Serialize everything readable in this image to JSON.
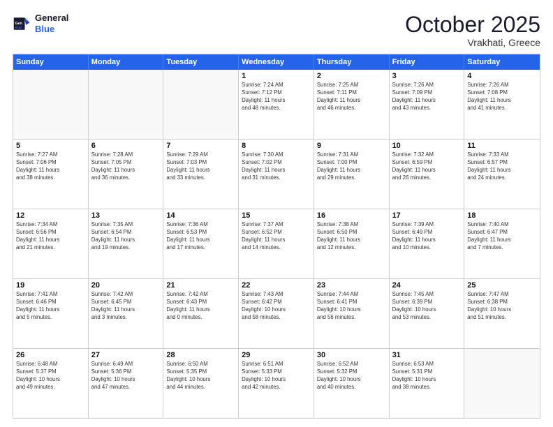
{
  "logo": {
    "line1": "General",
    "line2": "Blue"
  },
  "title": "October 2025",
  "subtitle": "Vrakhati, Greece",
  "days": [
    "Sunday",
    "Monday",
    "Tuesday",
    "Wednesday",
    "Thursday",
    "Friday",
    "Saturday"
  ],
  "rows": [
    [
      {
        "day": "",
        "info": ""
      },
      {
        "day": "",
        "info": ""
      },
      {
        "day": "",
        "info": ""
      },
      {
        "day": "1",
        "info": "Sunrise: 7:24 AM\nSunset: 7:12 PM\nDaylight: 11 hours\nand 48 minutes."
      },
      {
        "day": "2",
        "info": "Sunrise: 7:25 AM\nSunset: 7:11 PM\nDaylight: 11 hours\nand 46 minutes."
      },
      {
        "day": "3",
        "info": "Sunrise: 7:26 AM\nSunset: 7:09 PM\nDaylight: 11 hours\nand 43 minutes."
      },
      {
        "day": "4",
        "info": "Sunrise: 7:26 AM\nSunset: 7:08 PM\nDaylight: 11 hours\nand 41 minutes."
      }
    ],
    [
      {
        "day": "5",
        "info": "Sunrise: 7:27 AM\nSunset: 7:06 PM\nDaylight: 11 hours\nand 38 minutes."
      },
      {
        "day": "6",
        "info": "Sunrise: 7:28 AM\nSunset: 7:05 PM\nDaylight: 11 hours\nand 36 minutes."
      },
      {
        "day": "7",
        "info": "Sunrise: 7:29 AM\nSunset: 7:03 PM\nDaylight: 11 hours\nand 33 minutes."
      },
      {
        "day": "8",
        "info": "Sunrise: 7:30 AM\nSunset: 7:02 PM\nDaylight: 11 hours\nand 31 minutes."
      },
      {
        "day": "9",
        "info": "Sunrise: 7:31 AM\nSunset: 7:00 PM\nDaylight: 11 hours\nand 29 minutes."
      },
      {
        "day": "10",
        "info": "Sunrise: 7:32 AM\nSunset: 6:59 PM\nDaylight: 11 hours\nand 26 minutes."
      },
      {
        "day": "11",
        "info": "Sunrise: 7:33 AM\nSunset: 6:57 PM\nDaylight: 11 hours\nand 24 minutes."
      }
    ],
    [
      {
        "day": "12",
        "info": "Sunrise: 7:34 AM\nSunset: 6:56 PM\nDaylight: 11 hours\nand 21 minutes."
      },
      {
        "day": "13",
        "info": "Sunrise: 7:35 AM\nSunset: 6:54 PM\nDaylight: 11 hours\nand 19 minutes."
      },
      {
        "day": "14",
        "info": "Sunrise: 7:36 AM\nSunset: 6:53 PM\nDaylight: 11 hours\nand 17 minutes."
      },
      {
        "day": "15",
        "info": "Sunrise: 7:37 AM\nSunset: 6:52 PM\nDaylight: 11 hours\nand 14 minutes."
      },
      {
        "day": "16",
        "info": "Sunrise: 7:38 AM\nSunset: 6:50 PM\nDaylight: 11 hours\nand 12 minutes."
      },
      {
        "day": "17",
        "info": "Sunrise: 7:39 AM\nSunset: 6:49 PM\nDaylight: 11 hours\nand 10 minutes."
      },
      {
        "day": "18",
        "info": "Sunrise: 7:40 AM\nSunset: 6:47 PM\nDaylight: 11 hours\nand 7 minutes."
      }
    ],
    [
      {
        "day": "19",
        "info": "Sunrise: 7:41 AM\nSunset: 6:46 PM\nDaylight: 11 hours\nand 5 minutes."
      },
      {
        "day": "20",
        "info": "Sunrise: 7:42 AM\nSunset: 6:45 PM\nDaylight: 11 hours\nand 3 minutes."
      },
      {
        "day": "21",
        "info": "Sunrise: 7:42 AM\nSunset: 6:43 PM\nDaylight: 11 hours\nand 0 minutes."
      },
      {
        "day": "22",
        "info": "Sunrise: 7:43 AM\nSunset: 6:42 PM\nDaylight: 10 hours\nand 58 minutes."
      },
      {
        "day": "23",
        "info": "Sunrise: 7:44 AM\nSunset: 6:41 PM\nDaylight: 10 hours\nand 56 minutes."
      },
      {
        "day": "24",
        "info": "Sunrise: 7:45 AM\nSunset: 6:39 PM\nDaylight: 10 hours\nand 53 minutes."
      },
      {
        "day": "25",
        "info": "Sunrise: 7:47 AM\nSunset: 6:38 PM\nDaylight: 10 hours\nand 51 minutes."
      }
    ],
    [
      {
        "day": "26",
        "info": "Sunrise: 6:48 AM\nSunset: 5:37 PM\nDaylight: 10 hours\nand 49 minutes."
      },
      {
        "day": "27",
        "info": "Sunrise: 6:49 AM\nSunset: 5:36 PM\nDaylight: 10 hours\nand 47 minutes."
      },
      {
        "day": "28",
        "info": "Sunrise: 6:50 AM\nSunset: 5:35 PM\nDaylight: 10 hours\nand 44 minutes."
      },
      {
        "day": "29",
        "info": "Sunrise: 6:51 AM\nSunset: 5:33 PM\nDaylight: 10 hours\nand 42 minutes."
      },
      {
        "day": "30",
        "info": "Sunrise: 6:52 AM\nSunset: 5:32 PM\nDaylight: 10 hours\nand 40 minutes."
      },
      {
        "day": "31",
        "info": "Sunrise: 6:53 AM\nSunset: 5:31 PM\nDaylight: 10 hours\nand 38 minutes."
      },
      {
        "day": "",
        "info": ""
      }
    ]
  ]
}
